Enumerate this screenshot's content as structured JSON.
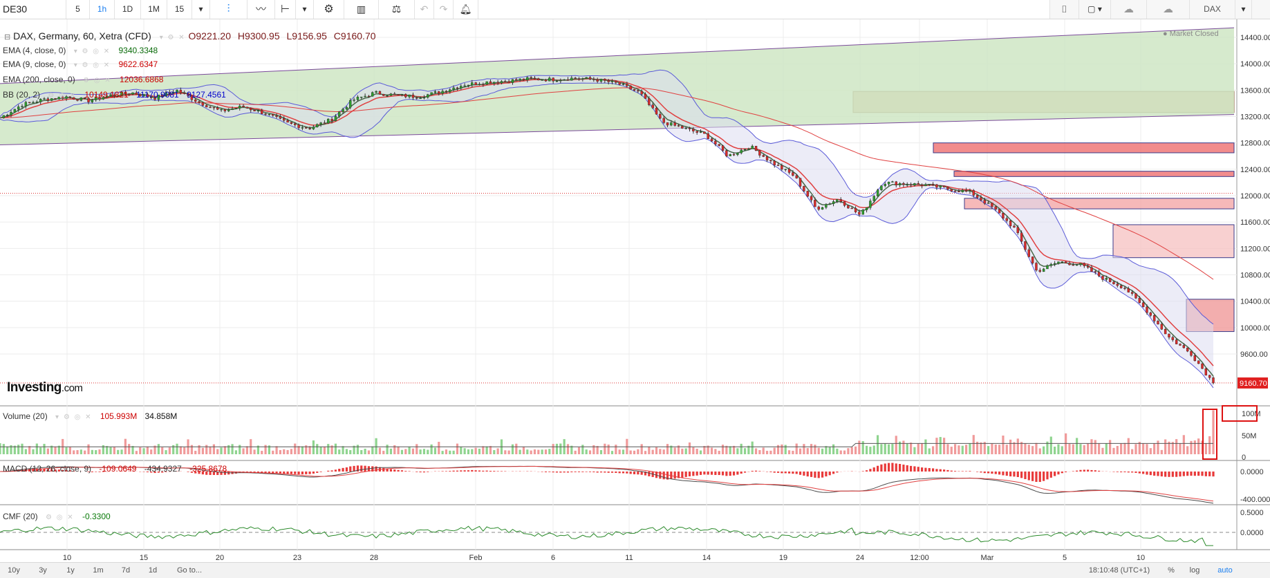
{
  "toolbar": {
    "symbol": "DE30",
    "intervals": [
      "5",
      "1h",
      "1D",
      "1M",
      "15"
    ],
    "active_interval": "1h",
    "right_symbol": "DAX"
  },
  "main_legend": {
    "title": "DAX, Germany, 60, Xetra (CFD)",
    "open": "O9221.20",
    "high": "H9300.95",
    "low": "L9156.95",
    "close": "C9160.70",
    "market_status": "Market Closed"
  },
  "indicators": [
    {
      "label": "EMA (4, close, 0)",
      "values": [
        "9340.3348"
      ],
      "colors": [
        "#0a6b0a"
      ]
    },
    {
      "label": "EMA (9, close, 0)",
      "values": [
        "9622.6347"
      ],
      "colors": [
        "#cc0000"
      ]
    },
    {
      "label": "EMA (200, close, 0)",
      "values": [
        "12036.6868"
      ],
      "colors": [
        "#cc0000"
      ]
    },
    {
      "label": "BB (20, 2)",
      "values": [
        "10149.1821",
        "11170.9081",
        "9127.4561"
      ],
      "colors": [
        "#cc0000",
        "#0000cc",
        "#0000cc"
      ]
    }
  ],
  "volume_legend": {
    "label": "Volume (20)",
    "v1": "105.993M",
    "v2": "34.858M"
  },
  "macd_legend": {
    "label": "MACD (12, 26, close, 9)",
    "v1": "-109.0649",
    "v2": "-434.9327",
    "v3": "-325.8678"
  },
  "cmf_legend": {
    "label": "CMF (20)",
    "v1": "-0.3300"
  },
  "price_axis": [
    "14400.00",
    "14000.00",
    "13600.00",
    "13200.00",
    "12800.00",
    "12400.00",
    "12000.00",
    "11600.00",
    "11200.00",
    "10800.00",
    "10400.00",
    "10000.00",
    "9600.00"
  ],
  "last_price_tag": "9160.70",
  "volume_axis": [
    "100M",
    "50M",
    "0"
  ],
  "macd_axis": [
    "0.0000",
    "-400.0000"
  ],
  "cmf_axis": [
    "0.5000",
    "0.0000"
  ],
  "time_axis": [
    "10",
    "15",
    "20",
    "23",
    "28",
    "Feb",
    "6",
    "11",
    "14",
    "19",
    "24",
    "12:00",
    "Mar",
    "5",
    "10"
  ],
  "logo": {
    "brand": "Investing",
    "suffix": ".com"
  },
  "bottom": {
    "ranges": [
      "10y",
      "3y",
      "1y",
      "1m",
      "7d",
      "1d"
    ],
    "goto": "Go to...",
    "clock": "18:10:48 (UTC+1)",
    "percent": "%",
    "log": "log",
    "auto": "auto"
  },
  "colors": {
    "up": "#2e9e2e",
    "down": "#d92b2b",
    "channel_fill": "#cfe6c4",
    "bb_line": "#5a5ad8",
    "bb_fill": "#dcdcf0"
  },
  "chart_data": {
    "type": "candlestick",
    "symbol": "DAX, Germany, 60, Xetra (CFD)",
    "interval": "60",
    "ylim": [
      9200,
      14600
    ],
    "x_categories": [
      "10",
      "15",
      "20",
      "23",
      "28",
      "Feb",
      "6",
      "11",
      "14",
      "19",
      "24",
      "12:00",
      "Mar",
      "5",
      "10"
    ],
    "close_path": [
      13180,
      13380,
      13460,
      13500,
      13440,
      13520,
      13560,
      13480,
      13600,
      13420,
      13280,
      13350,
      13250,
      13100,
      13020,
      13150,
      13450,
      13560,
      13520,
      13500,
      13580,
      13680,
      13720,
      13740,
      13770,
      13760,
      13780,
      13760,
      13700,
      13560,
      13120,
      13020,
      12920,
      12600,
      12750,
      12500,
      12300,
      11800,
      11950,
      11700,
      12200,
      12180,
      12160,
      12100,
      12050,
      11820,
      11500,
      10850,
      11000,
      10950,
      10750,
      10600,
      10250,
      9850,
      9600,
      9160.7
    ],
    "last_price": 9160.7,
    "indicators": {
      "ema_4": 9340.3348,
      "ema_9": 9622.6347,
      "ema_200": 12036.6868,
      "bollinger": {
        "middle": 10149.1821,
        "upper": 11170.9081,
        "lower": 9127.4561
      }
    },
    "volume": {
      "last": "105.993M",
      "average": "34.858M"
    },
    "macd": {
      "macd": -109.0649,
      "signal": -434.9327,
      "histogram": -325.8678
    },
    "cmf": -0.33
  }
}
